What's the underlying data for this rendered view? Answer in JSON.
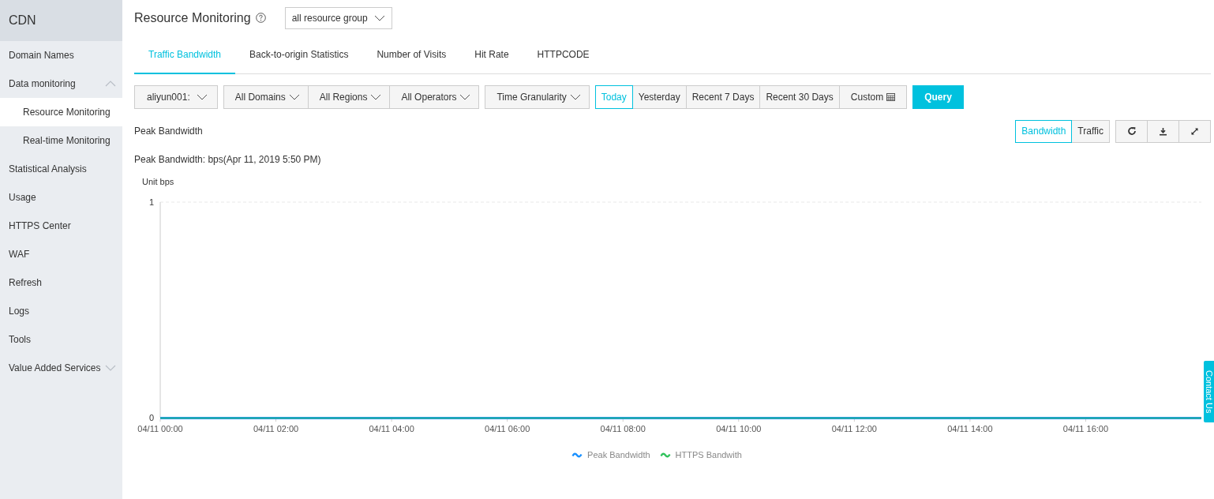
{
  "sidebar": {
    "title": "CDN",
    "items": [
      {
        "label": "Domain Names",
        "kind": "link",
        "selected": false
      },
      {
        "label": "Data monitoring",
        "kind": "group",
        "expanded": true,
        "selected": false,
        "children": [
          {
            "label": "Resource Monitoring",
            "selected": true
          },
          {
            "label": "Real-time Monitoring",
            "selected": false
          }
        ]
      },
      {
        "label": "Statistical Analysis",
        "kind": "link",
        "selected": false
      },
      {
        "label": "Usage",
        "kind": "link",
        "selected": false
      },
      {
        "label": "HTTPS Center",
        "kind": "link",
        "selected": false
      },
      {
        "label": "WAF",
        "kind": "link",
        "selected": false
      },
      {
        "label": "Refresh",
        "kind": "link",
        "selected": false
      },
      {
        "label": "Logs",
        "kind": "link",
        "selected": false
      },
      {
        "label": "Tools",
        "kind": "link",
        "selected": false
      },
      {
        "label": "Value Added Services",
        "kind": "group",
        "expanded": false,
        "selected": false
      }
    ]
  },
  "header": {
    "title": "Resource Monitoring",
    "resource_group": "all resource group"
  },
  "tabs": [
    {
      "label": "Traffic Bandwidth",
      "selected": true
    },
    {
      "label": "Back-to-origin Statistics",
      "selected": false
    },
    {
      "label": "Number of Visits",
      "selected": false
    },
    {
      "label": "Hit Rate",
      "selected": false
    },
    {
      "label": "HTTPCODE",
      "selected": false
    }
  ],
  "filters": {
    "account": "aliyun001:",
    "dropdowns": [
      "All Domains",
      "All Regions",
      "All Operators"
    ],
    "granularity": "Time Granularity",
    "ranges": [
      {
        "label": "Today",
        "selected": true,
        "kind": "text"
      },
      {
        "label": "Yesterday",
        "selected": false,
        "kind": "text"
      },
      {
        "label": "Recent 7 Days",
        "selected": false,
        "kind": "text"
      },
      {
        "label": "Recent 30 Days",
        "selected": false,
        "kind": "text"
      },
      {
        "label": "Custom",
        "selected": false,
        "kind": "calendar"
      }
    ],
    "query": "Query"
  },
  "panel": {
    "title": "Peak Bandwidth",
    "modes": [
      {
        "label": "Bandwidth",
        "selected": true
      },
      {
        "label": "Traffic",
        "selected": false
      }
    ],
    "subtitle": "Peak Bandwidth: bps(Apr 11, 2019 5:50 PM)",
    "chart_data": {
      "type": "line",
      "legend": "bottom",
      "ylabel": "Unit bps",
      "ylim": [
        0,
        1
      ],
      "yticks": [
        0,
        1
      ],
      "categories": [
        "04/11 00:00",
        "04/11 02:00",
        "04/11 04:00",
        "04/11 06:00",
        "04/11 08:00",
        "04/11 10:00",
        "04/11 12:00",
        "04/11 14:00",
        "04/11 16:00",
        null
      ],
      "series": [
        {
          "name": "Peak Bandwidth",
          "color": "#1890ff",
          "values": [
            0,
            0,
            0,
            0,
            0,
            0,
            0,
            0,
            0,
            0
          ]
        },
        {
          "name": "HTTPS Bandwith",
          "color": "#2fc25b",
          "values": [
            0,
            0,
            0,
            0,
            0,
            0,
            0,
            0,
            0,
            0
          ]
        }
      ]
    }
  },
  "contact": "Contact Us"
}
